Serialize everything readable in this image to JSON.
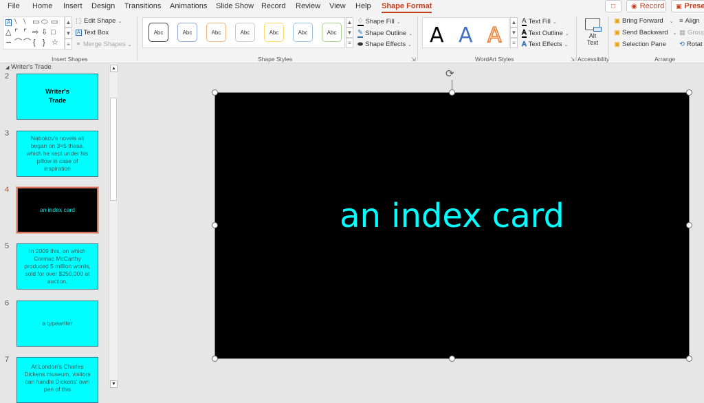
{
  "ribbon_tabs": [
    "File",
    "Home",
    "Insert",
    "Design",
    "Transitions",
    "Animations",
    "Slide Show",
    "Record",
    "Review",
    "View",
    "Help",
    "Shape Format"
  ],
  "active_tab": "Shape Format",
  "top_buttons": {
    "comment_icon": "comment-icon",
    "record_label": "Record",
    "present_label": "Presen"
  },
  "insert_shapes": {
    "group_label": "Insert Shapes",
    "edit_shape": "Edit Shape",
    "text_box": "Text Box",
    "merge_shapes": "Merge Shapes"
  },
  "shape_styles": {
    "group_label": "Shape Styles",
    "sample": "Abc",
    "swatches": [
      "#404040",
      "#8faadc",
      "#f4b183",
      "#c9c9c9",
      "#ffd966",
      "#9dc3e6",
      "#a9d18e"
    ],
    "shape_fill": "Shape Fill",
    "shape_outline": "Shape Outline",
    "shape_effects": "Shape Effects"
  },
  "wordart_styles": {
    "group_label": "WordArt Styles",
    "letters": [
      "A",
      "A",
      "A"
    ],
    "text_fill": "Text Fill",
    "text_outline": "Text Outline",
    "text_effects": "Text Effects"
  },
  "accessibility": {
    "group_label": "Accessibility",
    "alt_text_line1": "Alt",
    "alt_text_line2": "Text"
  },
  "arrange": {
    "group_label": "Arrange",
    "bring_forward": "Bring Forward",
    "send_backward": "Send Backward",
    "selection_pane": "Selection Pane",
    "align": "Align",
    "group": "Group",
    "rotate": "Rotat"
  },
  "slide_panel": {
    "section_name": "Writer's Trade",
    "slides": [
      {
        "number": "2",
        "text": "Writer's Trade",
        "style": "title"
      },
      {
        "number": "3",
        "text": "Nabokov's novels all began on 3×5 these, which he kept under his pillow in case of inspiration",
        "style": "normal"
      },
      {
        "number": "4",
        "text": "an index card",
        "style": "dark"
      },
      {
        "number": "5",
        "text": "In 2009 this, on which Cormac McCarthy produced 5 million words, sold for over $250,000 at auction.",
        "style": "normal"
      },
      {
        "number": "6",
        "text": "a typewriter",
        "style": "normal"
      },
      {
        "number": "7",
        "text": "At London's Charles Dickens museum, visitors can handle Dickens' own pen of this",
        "style": "normal"
      }
    ],
    "active_slide": "4"
  },
  "main_slide": {
    "text": "an index card",
    "background": "#000000",
    "text_color": "#00ffff"
  }
}
